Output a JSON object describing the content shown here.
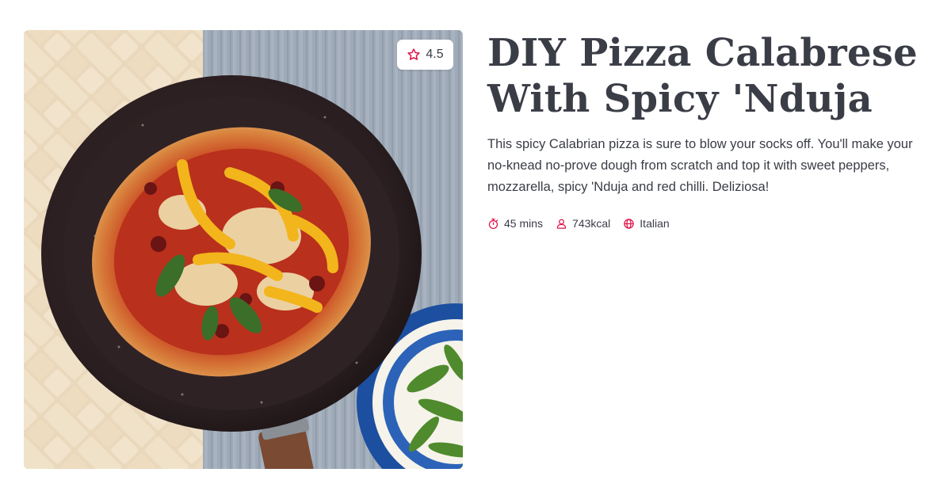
{
  "recipe": {
    "title_line1": "DIY Pizza Calabrese",
    "title_line2": "With Spicy 'Nduja",
    "description": "This spicy Calabrian pizza is sure to blow your socks off. You'll make your no-knead no-prove dough from scratch and top it with sweet peppers, mozzarella, spicy 'Nduja and red chilli. Deliziosa!",
    "rating": "4.5",
    "meta": {
      "time": "45 mins",
      "calories": "743kcal",
      "cuisine": "Italian"
    }
  },
  "icons": {
    "rating": "star-outline-icon",
    "time": "stopwatch-icon",
    "calories": "person-icon",
    "cuisine": "globe-icon"
  },
  "colors": {
    "accent": "#e0144a",
    "text": "#3a3d46",
    "background": "#ffffff"
  }
}
